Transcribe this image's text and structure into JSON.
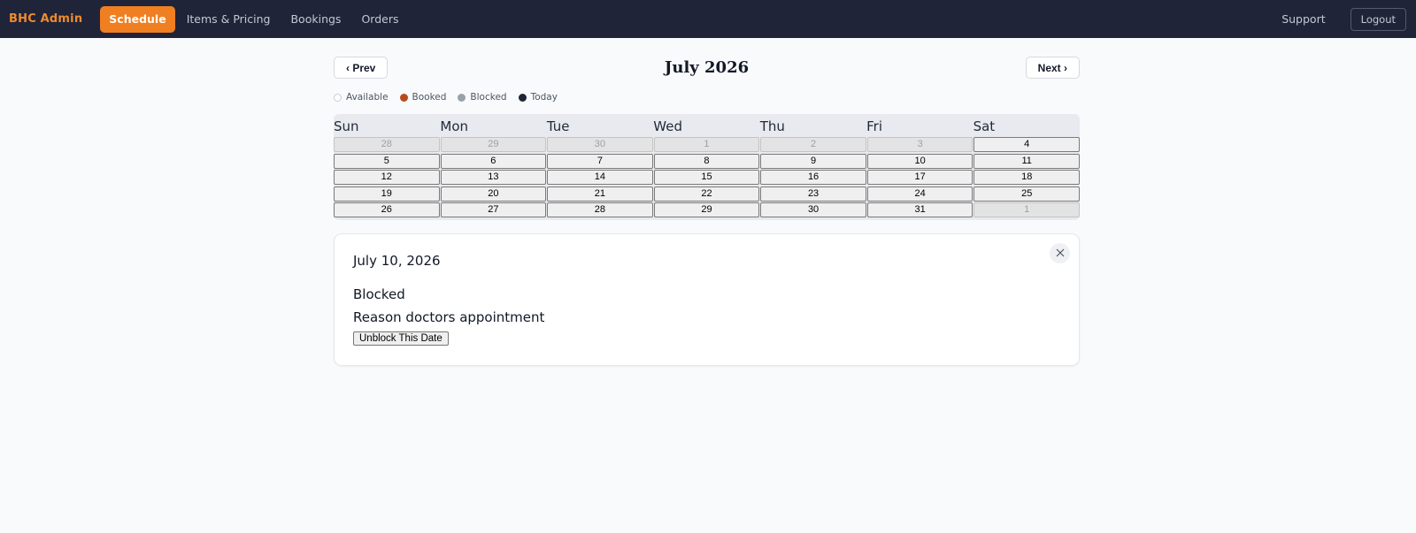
{
  "topbar": {
    "brand": "BHC Admin",
    "nav": [
      "Schedule",
      "Items & Pricing",
      "Bookings",
      "Orders"
    ],
    "support": "Support",
    "logout": "Logout"
  },
  "calendar_header": {
    "prev_label": "‹ Prev",
    "title": "July 2026",
    "next_label": "Next ›"
  },
  "legend": [
    {
      "label": "Available",
      "color": "#ffffff"
    },
    {
      "label": "Booked",
      "color": "#b84a1c"
    },
    {
      "label": "Blocked",
      "color": "#9aa0ad"
    },
    {
      "label": "Today",
      "color": "#1f2438"
    }
  ],
  "weekdays": [
    "Sun",
    "Mon",
    "Tue",
    "Wed",
    "Thu",
    "Fri",
    "Sat"
  ],
  "weeks": [
    [
      {
        "d": "28",
        "o": true
      },
      {
        "d": "29",
        "o": true
      },
      {
        "d": "30",
        "o": true
      },
      {
        "d": "1",
        "o": true
      },
      {
        "d": "2",
        "o": true
      },
      {
        "d": "3",
        "o": true
      },
      {
        "d": "4",
        "o": false
      }
    ],
    [
      {
        "d": "5",
        "o": false
      },
      {
        "d": "6",
        "o": false
      },
      {
        "d": "7",
        "o": false
      },
      {
        "d": "8",
        "o": false
      },
      {
        "d": "9",
        "o": false
      },
      {
        "d": "10",
        "o": false
      },
      {
        "d": "11",
        "o": false
      }
    ],
    [
      {
        "d": "12",
        "o": false
      },
      {
        "d": "13",
        "o": false
      },
      {
        "d": "14",
        "o": false
      },
      {
        "d": "15",
        "o": false
      },
      {
        "d": "16",
        "o": false
      },
      {
        "d": "17",
        "o": false
      },
      {
        "d": "18",
        "o": false
      }
    ],
    [
      {
        "d": "19",
        "o": false
      },
      {
        "d": "20",
        "o": false
      },
      {
        "d": "21",
        "o": false
      },
      {
        "d": "22",
        "o": false
      },
      {
        "d": "23",
        "o": false
      },
      {
        "d": "24",
        "o": false
      },
      {
        "d": "25",
        "o": false
      }
    ],
    [
      {
        "d": "26",
        "o": false
      },
      {
        "d": "27",
        "o": false
      },
      {
        "d": "28",
        "o": false
      },
      {
        "d": "29",
        "o": false
      },
      {
        "d": "30",
        "o": false
      },
      {
        "d": "31",
        "o": false
      },
      {
        "d": "1",
        "o": true
      }
    ]
  ],
  "detail": {
    "date": "July 10, 2026",
    "status": "Blocked",
    "reason": "Reason doctors appointment",
    "unblock_label": "Unblock This Date"
  },
  "colors": {
    "accent": "#f07f22",
    "topbar": "#1f2438"
  }
}
